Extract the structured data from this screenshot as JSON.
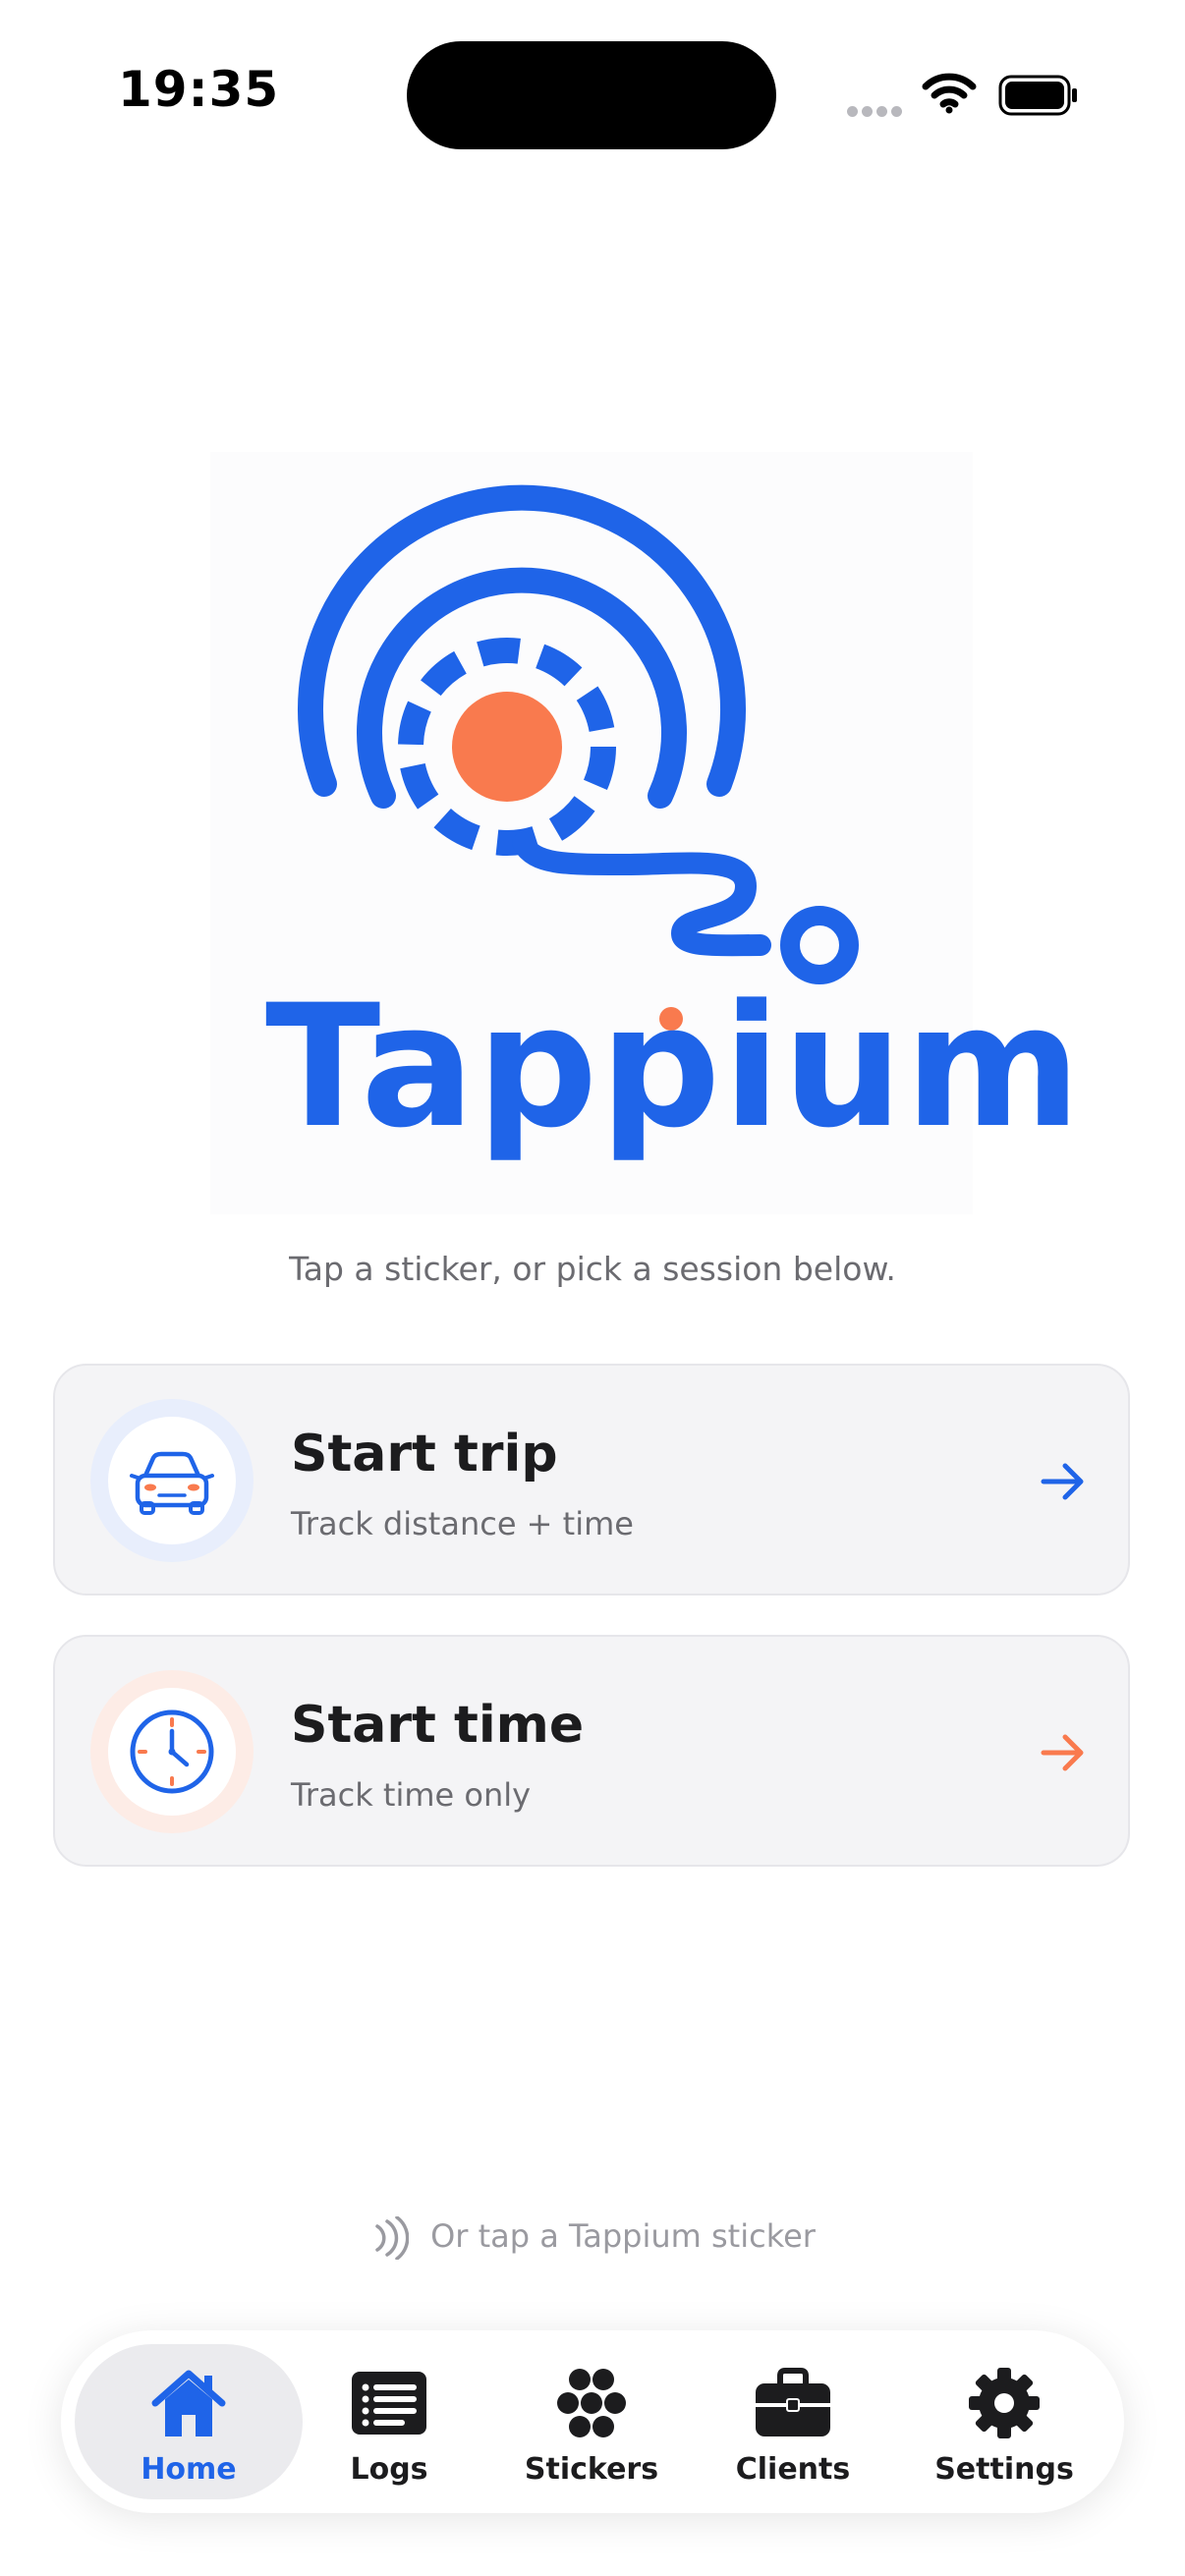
{
  "status_bar": {
    "time": "19:35"
  },
  "brand": {
    "name": "Tappium"
  },
  "colors": {
    "blue": "#1f64e8",
    "orange": "#f97a4e"
  },
  "subtitle": "Tap a sticker, or pick a session below.",
  "actions": [
    {
      "title": "Start trip",
      "subtitle": "Track distance + time",
      "icon": "car-icon",
      "accent": "#1f64e8"
    },
    {
      "title": "Start time",
      "subtitle": "Track time only",
      "icon": "clock-icon",
      "accent": "#f97a4e"
    }
  ],
  "hint": {
    "text": "Or tap a Tappium sticker",
    "icon": "nfc-icon"
  },
  "tabs": [
    {
      "label": "Home",
      "icon": "home-icon",
      "active": true
    },
    {
      "label": "Logs",
      "icon": "list-icon",
      "active": false
    },
    {
      "label": "Stickers",
      "icon": "stickers-icon",
      "active": false
    },
    {
      "label": "Clients",
      "icon": "briefcase-icon",
      "active": false
    },
    {
      "label": "Settings",
      "icon": "gear-icon",
      "active": false
    }
  ]
}
